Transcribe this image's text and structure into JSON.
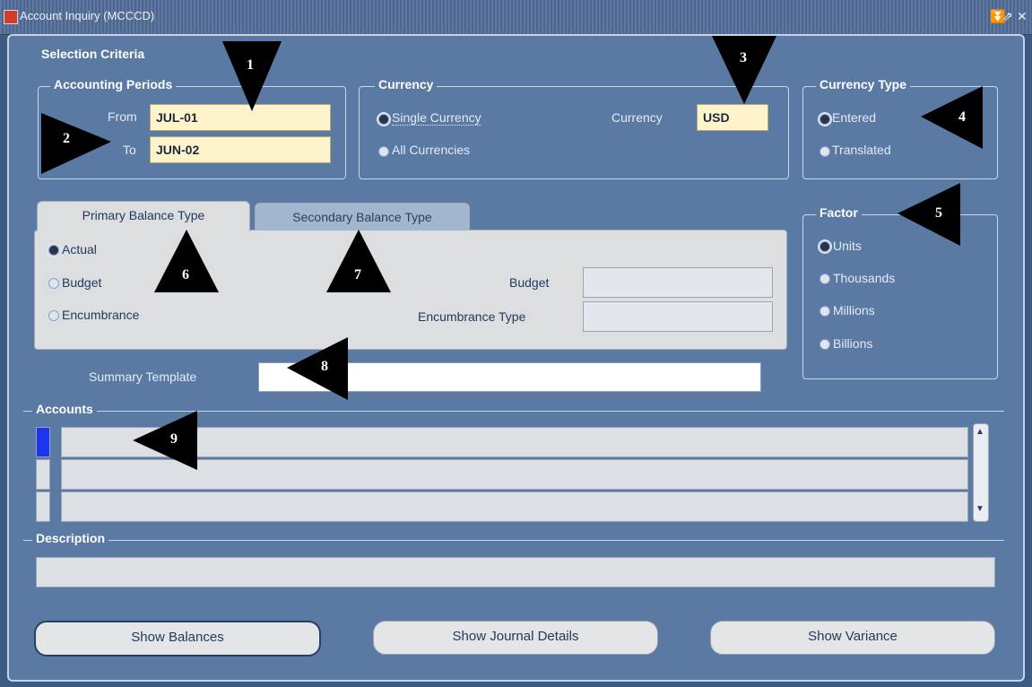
{
  "window": {
    "title": "Account Inquiry (MCCCD)",
    "controls": [
      "↗",
      "☐",
      "✕"
    ]
  },
  "selection": {
    "label": "Selection Criteria",
    "periods": {
      "label": "Accounting Periods",
      "from_label": "From",
      "from_value": "JUL-01",
      "to_label": "To",
      "to_value": "JUN-02"
    },
    "currency": {
      "label": "Currency",
      "single_label": "Single Currency",
      "all_label": "All Currencies",
      "currency_label": "Currency",
      "currency_value": "USD",
      "selected": "Single Currency"
    },
    "currency_type": {
      "label": "Currency Type",
      "options": [
        "Entered",
        "Translated"
      ],
      "selected": "Entered"
    },
    "balance_tabs": {
      "primary_label": "Primary Balance Type",
      "secondary_label": "Secondary Balance Type",
      "options": [
        "Actual",
        "Budget",
        "Encumbrance"
      ],
      "selected": "Actual",
      "budget_label": "Budget",
      "encumbrance_type_label": "Encumbrance Type"
    },
    "factor": {
      "label": "Factor",
      "options": [
        "Units",
        "Thousands",
        "Millions",
        "Billions"
      ],
      "selected": "Units"
    },
    "summary_template_label": "Summary Template"
  },
  "accounts": {
    "label": "Accounts",
    "rows": [
      "",
      "",
      ""
    ]
  },
  "description": {
    "label": "Description"
  },
  "buttons": {
    "show_balances": "Show Balances",
    "show_journal_details": "Show Journal Details",
    "show_variance": "Show Variance"
  },
  "callouts": [
    "1",
    "2",
    "3",
    "4",
    "5",
    "6",
    "7",
    "8",
    "9"
  ]
}
